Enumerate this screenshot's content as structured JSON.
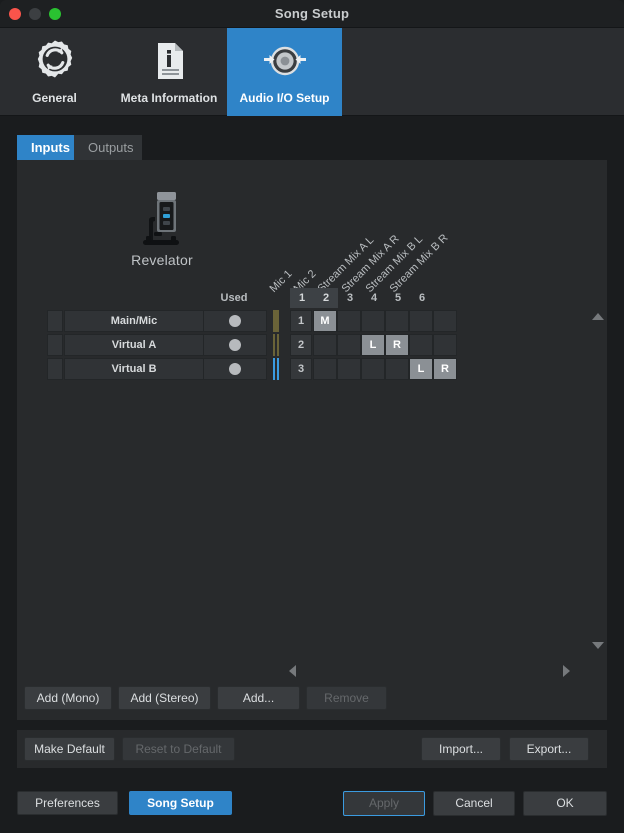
{
  "window": {
    "title": "Song Setup",
    "traffic_lights": [
      "close",
      "minimize",
      "maximize"
    ]
  },
  "toolbar": {
    "items": [
      {
        "label": "General",
        "icon": "gear-refresh-icon",
        "active": false
      },
      {
        "label": "Meta Information",
        "icon": "document-info-icon",
        "active": false
      },
      {
        "label": "Audio I/O Setup",
        "icon": "audio-io-icon",
        "active": true
      }
    ],
    "accent_color": "#2f84c8"
  },
  "tabs": [
    {
      "label": "Inputs",
      "active": true
    },
    {
      "label": "Outputs",
      "active": false
    }
  ],
  "device": {
    "name": "Revelator",
    "icon": "usb-microphone-icon"
  },
  "routing_table": {
    "used_header": "Used",
    "channel_labels": [
      "Mic 1",
      "Mic 2",
      "Stream Mix A L",
      "Stream Mix A R",
      "Stream Mix B L",
      "Stream Mix B R"
    ],
    "channel_numbers": [
      "1",
      "2",
      "3",
      "4",
      "5",
      "6"
    ],
    "channel_used": [
      true,
      true,
      false,
      false,
      false,
      false
    ],
    "rows": [
      {
        "name": "Main/Mic",
        "used": true,
        "number": "1",
        "meter": {
          "style": "wide",
          "color": "#6a6338"
        },
        "assignments": [
          "M",
          "",
          "",
          "",
          "",
          ""
        ]
      },
      {
        "name": "Virtual A",
        "used": true,
        "number": "2",
        "meter": {
          "style": "pair",
          "color": "#6a6338"
        },
        "assignments": [
          "",
          "",
          "L",
          "R",
          "",
          ""
        ]
      },
      {
        "name": "Virtual B",
        "used": true,
        "number": "3",
        "meter": {
          "style": "pair",
          "color": "#3b9be0"
        },
        "assignments": [
          "",
          "",
          "",
          "",
          "L",
          "R"
        ]
      }
    ]
  },
  "scroll": {
    "up": "scroll-up-arrow",
    "down": "scroll-down-arrow",
    "left": "scroll-left-arrow",
    "right": "scroll-right-arrow"
  },
  "add_bar": [
    {
      "label": "Add (Mono)",
      "disabled": false
    },
    {
      "label": "Add (Stereo)",
      "disabled": false
    },
    {
      "label": "Add...",
      "disabled": false
    },
    {
      "label": "Remove",
      "disabled": true
    }
  ],
  "default_bar": {
    "left": [
      {
        "label": "Make Default",
        "disabled": false
      },
      {
        "label": "Reset to Default",
        "disabled": true
      }
    ],
    "right": [
      {
        "label": "Import...",
        "disabled": false
      },
      {
        "label": "Export...",
        "disabled": false
      }
    ]
  },
  "footer": {
    "left": [
      {
        "label": "Preferences",
        "primary": false
      },
      {
        "label": "Song Setup",
        "primary": true
      }
    ],
    "right": [
      {
        "label": "Apply",
        "disabled": true,
        "focused": true
      },
      {
        "label": "Cancel",
        "disabled": false,
        "focused": false
      },
      {
        "label": "OK",
        "disabled": false,
        "focused": false
      }
    ]
  }
}
